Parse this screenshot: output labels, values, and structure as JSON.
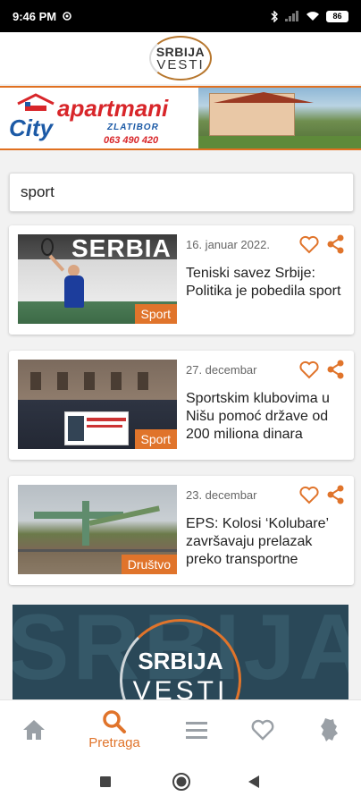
{
  "status_bar": {
    "time": "9:46 PM",
    "battery": "86",
    "icons": [
      "settings-gear-icon",
      "bluetooth-icon",
      "cell-signal-icon",
      "wifi-icon",
      "battery-icon"
    ]
  },
  "header": {
    "logo_line1": "SRBIJA",
    "logo_line2": "VESTI"
  },
  "ad": {
    "brand_city": "City",
    "brand_apartmani": "apartmani",
    "brand_zlatibor": "ZLATIBOR",
    "phone": "063 490 420"
  },
  "search": {
    "value": "sport"
  },
  "articles": [
    {
      "date": "16. januar 2022.",
      "title": "Teniski savez Srbije: Politika je pobedila sport",
      "tag": "Sport",
      "image_text": "SERBIA"
    },
    {
      "date": "27. decembar",
      "title": "Sportskim klubovima u Nišu pomoć države od 200 miliona dinara",
      "tag": "Sport"
    },
    {
      "date": "23. decembar",
      "title": "EPS: Kolosi ‘Kolubare’ završavaju prelazak preko transportne",
      "tag": "Društvo"
    }
  ],
  "promo": {
    "bg_text": "SRBIJA",
    "line1": "SRBIJA",
    "line2": "VESTI"
  },
  "bottom_nav": {
    "items": [
      {
        "icon": "home-icon",
        "label": ""
      },
      {
        "icon": "search-icon",
        "label": "Pretraga",
        "active": true
      },
      {
        "icon": "menu-icon",
        "label": ""
      },
      {
        "icon": "heart-icon",
        "label": ""
      },
      {
        "icon": "serbia-map-icon",
        "label": ""
      }
    ]
  },
  "colors": {
    "accent": "#e0742b",
    "icon_gray": "#9aa0a6"
  }
}
